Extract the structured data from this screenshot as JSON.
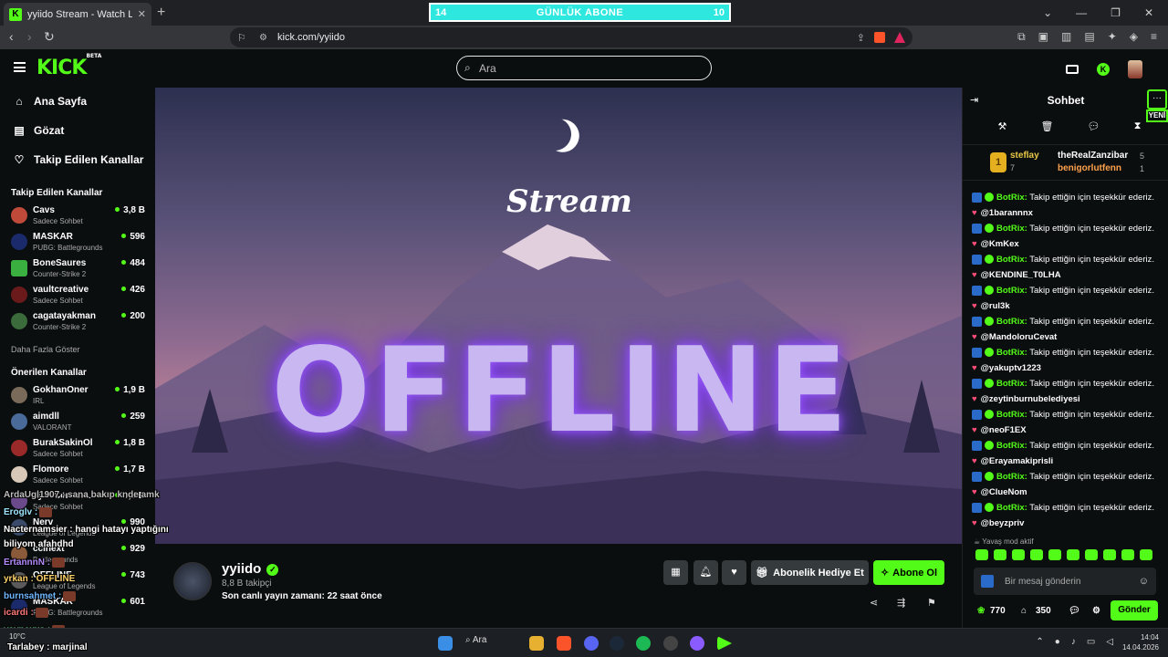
{
  "browser": {
    "tab_title": "yyiido Stream - Watch Live on Kic",
    "url": "kick.com/yyiido"
  },
  "sub_bar": {
    "left": "14",
    "label": "GÜNLÜK ABONE",
    "right": "10"
  },
  "header": {
    "logo": "KICK",
    "logo_badge": "BETA",
    "search_placeholder": "Ara"
  },
  "sidebar": {
    "nav": [
      {
        "label": "Ana Sayfa",
        "icon": "home-icon"
      },
      {
        "label": "Gözat",
        "icon": "browse-icon"
      },
      {
        "label": "Takip Edilen Kanallar",
        "icon": "heart-icon"
      }
    ],
    "followed_header": "Takip Edilen Kanallar",
    "followed": [
      {
        "name": "Cavs",
        "category": "Sadece Sohbet",
        "viewers": "3,8 B"
      },
      {
        "name": "MASKAR",
        "category": "PUBG: Battlegrounds",
        "viewers": "596"
      },
      {
        "name": "BoneSaures",
        "category": "Counter-Strike 2",
        "viewers": "484"
      },
      {
        "name": "vaultcreative",
        "category": "Sadece Sohbet",
        "viewers": "426"
      },
      {
        "name": "cagatayakman",
        "category": "Counter-Strike 2",
        "viewers": "200"
      }
    ],
    "show_more": "Daha Fazla Göster",
    "recommended_header": "Önerilen Kanallar",
    "recommended": [
      {
        "name": "GokhanOner",
        "category": "IRL",
        "viewers": "1,9 B"
      },
      {
        "name": "aimdll",
        "category": "VALORANT",
        "viewers": "259"
      },
      {
        "name": "BurakSakinOl",
        "category": "Sadece Sohbet",
        "viewers": "1,8 B"
      },
      {
        "name": "Flomore",
        "category": "Sadece Sohbet",
        "viewers": "1,7 B"
      },
      {
        "name": "LyneCereLoL",
        "category": "Sadece Sohbet",
        "viewers": "1,3 B"
      },
      {
        "name": "Nerv",
        "category": "League of Legends",
        "viewers": "990"
      },
      {
        "name": "ccinext",
        "category": "Battlegrounds",
        "viewers": "929"
      },
      {
        "name": "OFFLINE",
        "category": "League of Legends",
        "viewers": "743"
      },
      {
        "name": "MASKAR",
        "category": "PUBG: Battlegrounds",
        "viewers": "601"
      }
    ]
  },
  "overlay_chat": [
    {
      "text": "ArdaUgl1907 : sana bakıp knde amk",
      "color": "#bdbdbd"
    },
    {
      "text": "Eroglv :",
      "color": "#9ee8ff"
    },
    {
      "text": "Nacternamsier : hangi hatayı yaptığını",
      "color": "#ffffff"
    },
    {
      "text": "biliyom afahdhd",
      "color": "#ffffff"
    },
    {
      "text": "ErtannnN :",
      "color": "#b58cff"
    },
    {
      "text": "yrkan : OFFLINE",
      "color": "#ffd36b"
    },
    {
      "text": "burnsahmet :",
      "color": "#6fb7ff"
    },
    {
      "text": "icardi :",
      "color": "#ff7a7a"
    },
    {
      "text": "vaynexxs :",
      "color": "#7dffb0"
    },
    {
      "text": "Tarlabey : marjinal",
      "color": "#ffffff"
    }
  ],
  "player": {
    "script_title": "Stream",
    "offline_text": "OFFLINE"
  },
  "channel": {
    "name": "yyiido",
    "followers": "8,8 B takipçi",
    "last_live": "Son canlı yayın zamanı: 22 saat önce",
    "gift_label": "Abonelik Hediye Et",
    "subscribe_label": "Abone Ol"
  },
  "chat": {
    "title": "Sohbet",
    "new_badge": "YENİ",
    "leaderboard": [
      {
        "name": "steflay",
        "count": "7",
        "color": "#e9c846"
      },
      {
        "name": "theRealZanzibar",
        "count": "5",
        "color": "#ffffff"
      },
      {
        "name": "benigorlutfenn",
        "count": "1",
        "color": "#ffa24d"
      }
    ],
    "rank": "1",
    "bot_name": "BotRix:",
    "bot_text": "Takip ettiğin için teşekkür ederiz.",
    "messages": [
      "@1barannnx",
      "@KmKex",
      "@KENDINE_T0LHA",
      "@rul3k",
      "@MandoloruCevat",
      "@yakuptv1223",
      "@zeytinburnubelediyesi",
      "@neoF1EX",
      "@Erayamakiprisli",
      "@ClueNom",
      "@beyzpriv"
    ],
    "slow_mode": "Yavaş mod aktif",
    "input_placeholder": "Bir mesaj gönderin",
    "points": "770",
    "store": "350",
    "send": "Gönder"
  },
  "taskbar": {
    "temp": "10°C",
    "search": "Ara",
    "time": "14:04",
    "date": "14.04.2026"
  }
}
